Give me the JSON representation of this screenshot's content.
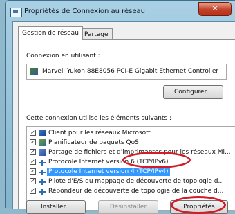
{
  "window": {
    "title": "Propriétés de Connexion au réseau",
    "close_label": "✕"
  },
  "tabs": [
    {
      "label": "Gestion de réseau",
      "active": true
    },
    {
      "label": "Partage",
      "active": false
    }
  ],
  "connect_using": {
    "label": "Connexion en utilisant :",
    "adapter": "Marvell Yukon 88E8056 PCI-E Gigabit Ethernet Controller",
    "configure_label": "Configurer..."
  },
  "components": {
    "label": "Cette connexion utilise les éléments suivants :",
    "items": [
      {
        "label": "Client pour les réseaux Microsoft",
        "checked": true,
        "icon": "client-icon"
      },
      {
        "label": "Planificateur de paquets QoS",
        "checked": true,
        "icon": "scheduler-icon"
      },
      {
        "label": "Partage de fichiers et d'imprimantes pour les réseaux Mi...",
        "checked": true,
        "icon": "share-icon"
      },
      {
        "label": "Protocole Internet version 6 (TCP/IPv6)",
        "checked": true,
        "icon": "protocol-icon"
      },
      {
        "label": "Protocole Internet version 4 (TCP/IPv4)",
        "checked": true,
        "icon": "protocol-icon",
        "selected": true
      },
      {
        "label": "Pilote d'E/S du mappage de découverte de topologie d...",
        "checked": true,
        "icon": "protocol-icon"
      },
      {
        "label": "Répondeur de découverte de topologie de la couche d...",
        "checked": true,
        "icon": "protocol-icon"
      }
    ]
  },
  "buttons": {
    "install": "Installer...",
    "uninstall": "Désinstaller",
    "properties": "Propriétés"
  },
  "colors": {
    "highlight_ellipse": "#d41b28",
    "selection": "#3399ff"
  }
}
